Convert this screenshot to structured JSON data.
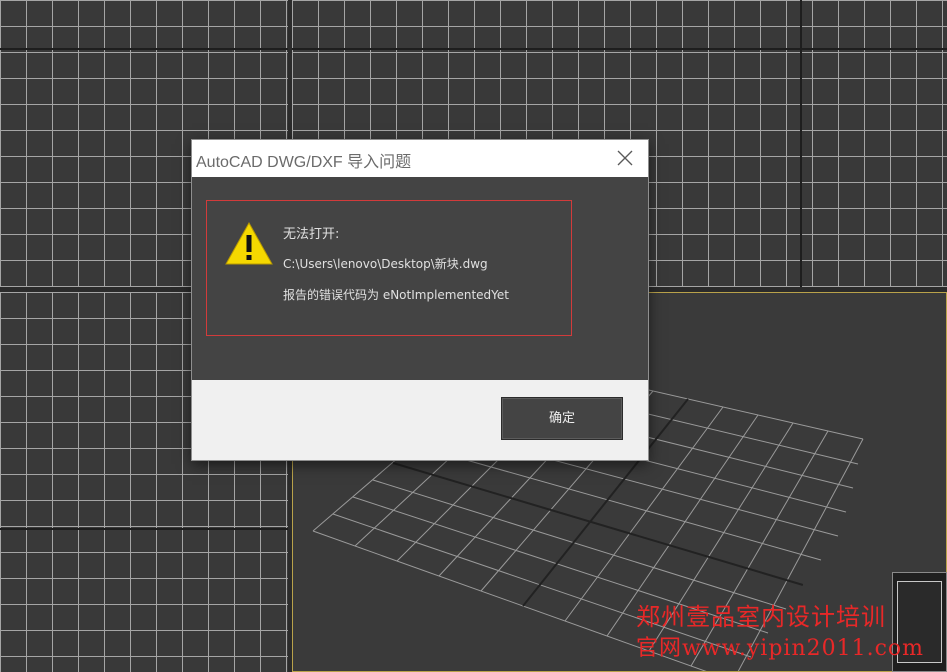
{
  "dialog": {
    "title": "AutoCAD DWG/DXF 导入问题",
    "message_line1": "无法打开:",
    "message_line2": "C:\\Users\\lenovo\\Desktop\\新块.dwg",
    "message_line3": "报告的错误代码为 eNotImplementedYet",
    "ok_label": "确定"
  },
  "watermark": {
    "line1": "郑州壹品室内设计培训",
    "line2": "官网www.yipin2011.com"
  },
  "colors": {
    "viewport_bg": "#393939",
    "grid_line": "#a5a5a5",
    "active_viewport_border": "#b9a24a",
    "error_border": "#d23b3b",
    "watermark": "#e82828"
  },
  "icons": {
    "warning": "warning-icon",
    "close": "close-icon"
  }
}
